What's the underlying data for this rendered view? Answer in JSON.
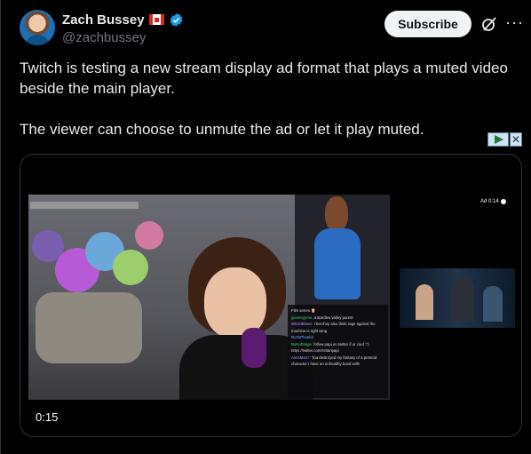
{
  "author": {
    "display_name": "Zach Bussey",
    "handle": "@zachbussey",
    "flag_icon": "canada-flag-icon",
    "verified_icon": "verified-badge-icon",
    "verified_color": "#1d9bf0"
  },
  "header": {
    "subscribe_label": "Subscribe",
    "grok_icon": "grok-icon",
    "more_icon": "more-icon",
    "more_glyph": "···"
  },
  "tweet": {
    "paragraph_1": "Twitch is testing a new stream display ad format that plays a muted video beside the main player.",
    "paragraph_2": "The viewer can choose to unmute the ad or let it play muted."
  },
  "adchoices": {
    "icon": "adchoices-icon",
    "close_glyph": "✕"
  },
  "media": {
    "timestamp": "0:15",
    "ad_label": "Ad 0:14",
    "chat_lines": [
      {
        "name": "",
        "text": "Film series 🍿",
        "color": "#dddddd"
      },
      {
        "name": "gosleepyme:",
        "text": "a stardew valley purest",
        "color": "#3fd36b"
      },
      {
        "name": "WhistlBlows:",
        "text": "I bet they also think rage against the machine is right wing",
        "color": "#c58bff"
      },
      {
        "name": "GoToPhoebe",
        "text": "",
        "color": "#6fb6ff"
      },
      {
        "name": "BeltedMage:",
        "text": "follow papi on twitter if ur cool :^) https://twitter.com/rottanpapi",
        "color": "#3fd36b"
      },
      {
        "name": "AriesMan7:",
        "text": "You destroyed my fantasy of a pretend character I have an unhealthy bond with!",
        "color": "#c58bff"
      }
    ]
  }
}
